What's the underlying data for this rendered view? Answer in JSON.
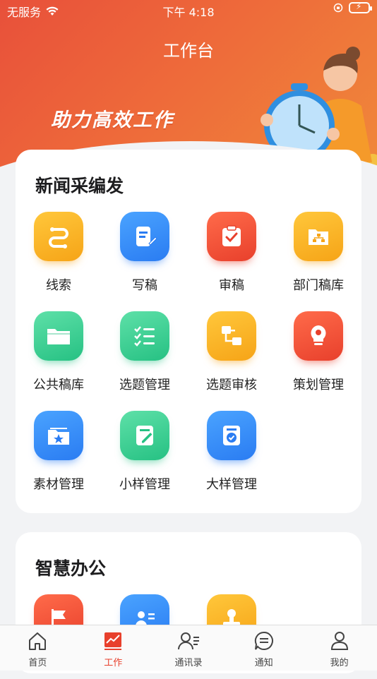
{
  "status": {
    "carrier": "无服务",
    "time": "下午 4:18"
  },
  "header": {
    "title": "工作台",
    "slogan": "助力高效工作"
  },
  "colors": {
    "accent": "#e8402c",
    "yellow": "#f6a417",
    "blue": "#2a7cf2",
    "green": "#26c183"
  },
  "sections": [
    {
      "title": "新闻采编发",
      "apps": [
        {
          "label": "线索",
          "icon": "route-icon",
          "color": "yellow"
        },
        {
          "label": "写稿",
          "icon": "edit-document-icon",
          "color": "blue"
        },
        {
          "label": "审稿",
          "icon": "clipboard-check-icon",
          "color": "red"
        },
        {
          "label": "部门稿库",
          "icon": "folder-org-icon",
          "color": "yellow"
        },
        {
          "label": "公共稿库",
          "icon": "folder-icon",
          "color": "green"
        },
        {
          "label": "选题管理",
          "icon": "checklist-icon",
          "color": "green"
        },
        {
          "label": "选题审核",
          "icon": "flow-icon",
          "color": "yellow"
        },
        {
          "label": "策划管理",
          "icon": "lightbulb-icon",
          "color": "red"
        },
        {
          "label": "素材管理",
          "icon": "star-folder-icon",
          "color": "blue"
        },
        {
          "label": "小样管理",
          "icon": "note-edit-icon",
          "color": "green"
        },
        {
          "label": "大样管理",
          "icon": "badge-check-icon",
          "color": "blue"
        }
      ]
    },
    {
      "title": "智慧办公",
      "apps": [
        {
          "label": "",
          "icon": "flag-icon",
          "color": "red"
        },
        {
          "label": "",
          "icon": "contact-card-icon",
          "color": "blue"
        },
        {
          "label": "",
          "icon": "stamp-icon",
          "color": "yellow"
        }
      ]
    }
  ],
  "tabbar": {
    "items": [
      {
        "label": "首页",
        "icon": "home-icon",
        "active": false
      },
      {
        "label": "工作",
        "icon": "chart-icon",
        "active": true
      },
      {
        "label": "通讯录",
        "icon": "contacts-icon",
        "active": false
      },
      {
        "label": "通知",
        "icon": "message-icon",
        "active": false
      },
      {
        "label": "我的",
        "icon": "user-icon",
        "active": false
      }
    ]
  }
}
